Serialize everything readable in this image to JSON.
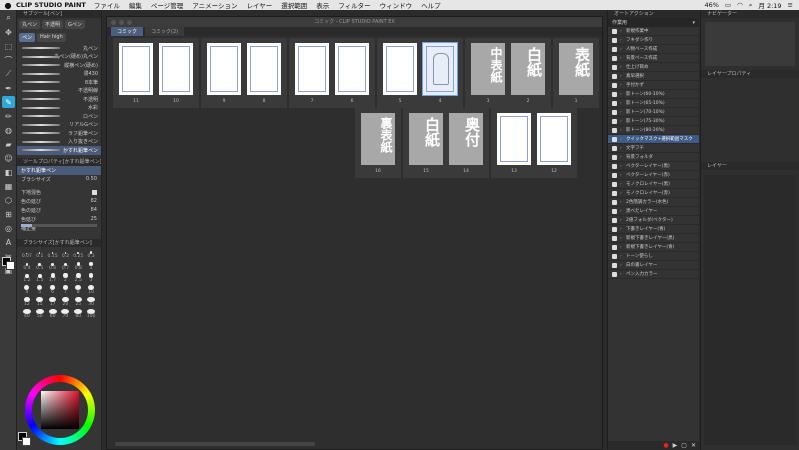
{
  "menubar": {
    "apple": "",
    "app_name": "CLIP STUDIO PAINT",
    "items": [
      "ファイル",
      "編集",
      "ページ管理",
      "アニメーション",
      "レイヤー",
      "選択範囲",
      "表示",
      "フィルター",
      "ウィンドウ",
      "ヘルプ"
    ],
    "battery": "46%",
    "clock": "月 2:19"
  },
  "tools": [
    "⌕",
    "✥",
    "⬚",
    "▦",
    "⟋",
    "⌒",
    "✎",
    "✏",
    "✒",
    "▰",
    "◍",
    "☺",
    "⊞",
    "T",
    "✂",
    "◧",
    "⬡",
    "A",
    "◎",
    "▣"
  ],
  "leftpanel": {
    "subtool_title": "サブツール[ペン]",
    "tabs": [
      "丸ペン",
      "不透明",
      "Gペン",
      "ペン",
      "Hair high"
    ],
    "brushes": [
      "丸ペン",
      "丸ペン(硬め)丸ペン",
      "縦横ペン(硬め)",
      "漫430",
      "8本筆",
      "不透明線",
      "不透明",
      "水彩",
      "ロペン",
      "リアルGペン",
      "ラフ鉛筆ペン",
      "入り抜きペン",
      "かすれ鉛筆ペン"
    ],
    "selected_brush_index": 12,
    "tooprop_title": "ツールプロパティ[かすれ鉛筆ペン]",
    "preview_label": "かすれ鉛筆ペン",
    "brush_size_label": "ブラシサイズ",
    "brush_size_value": "0.50",
    "props": [
      {
        "label": "下地混色",
        "value": ""
      },
      {
        "label": "色の延び",
        "value": "82"
      },
      {
        "label": "色の延び",
        "value": "84"
      },
      {
        "label": "色延び",
        "value": "25"
      },
      {
        "label": "補正量",
        "value": ""
      }
    ],
    "size_title": "ブラシサイズ[かすれ鉛筆ペン]",
    "sizes": [
      "0.07",
      "0.1",
      "0.15",
      "0.2",
      "0.25",
      "0.3",
      "0.4",
      "0.5",
      "0.6",
      "0.7",
      "0.8",
      "1",
      "1.2",
      "1.5",
      "1.7",
      "2",
      "2.5",
      "3",
      "4",
      "5",
      "6",
      "7",
      "8",
      "10",
      "12",
      "15",
      "17",
      "20",
      "25",
      "30",
      "40",
      "50",
      "60",
      "70",
      "80",
      "100"
    ],
    "color_wheel_label": "カラーサークル"
  },
  "canvas": {
    "window_title": "コミック - CLIP STUDIO PAINT EX",
    "tabs": [
      "コミック",
      "コミック(2)"
    ],
    "pages_row1": [
      {
        "num": "11",
        "type": "blank"
      },
      {
        "num": "10",
        "type": "blank"
      },
      {
        "num": "9",
        "type": "blank"
      },
      {
        "num": "8",
        "type": "blank"
      },
      {
        "num": "7",
        "type": "blank"
      },
      {
        "num": "6",
        "type": "blank"
      },
      {
        "num": "5",
        "type": "blank"
      },
      {
        "num": "4",
        "type": "sketch"
      },
      {
        "num": "3",
        "type": "gray",
        "text": "中表紙"
      },
      {
        "num": "2",
        "type": "gray",
        "text": "白紙"
      },
      {
        "num": "1",
        "type": "gray",
        "text": "表紙"
      }
    ],
    "pages_row2": [
      {
        "num": "16",
        "type": "gray",
        "text": "裏表紙"
      },
      {
        "num": "15",
        "type": "gray",
        "text": "白紙"
      },
      {
        "num": "14",
        "type": "gray",
        "text": "奥付"
      },
      {
        "num": "13",
        "type": "blank"
      },
      {
        "num": "12",
        "type": "blank"
      }
    ]
  },
  "rightpanel": {
    "title": "オートアクション",
    "set_name": "作業用",
    "rows": [
      "新規作業中",
      "フキダシ作り",
      "人物ベース作成",
      "背景ベース作成",
      "仕上げ目め",
      "素早選択",
      "手付かず",
      "影トーン(60-10%)",
      "影トーン(65-10%)",
      "影トーン(70-10%)",
      "影トーン(75-30%)",
      "影トーン(80-20%)",
      "クイックマスク+選択範囲マスク",
      "文字フチ",
      "背景フォルダ",
      "ベクターレイヤー(黒)",
      "ベクターレイヤー(赤)",
      "モノクロレイヤー(黒)",
      "モノクロレイヤー(赤)",
      "2色階調カラー(水色)",
      "黒べたレイヤー",
      "2値フォルダ(ベクター)",
      "下書きレイヤー(青)",
      "新規下書きレイヤー(黒)",
      "新規下書きレイヤー(青)",
      "トーン使らし",
      "白の書レイヤー",
      "ペン入力カラー"
    ],
    "selected_index": 12
  },
  "farright": {
    "navigator": "ナビゲーター",
    "layer_property": "レイヤープロパティ",
    "layer": "レイヤー"
  }
}
